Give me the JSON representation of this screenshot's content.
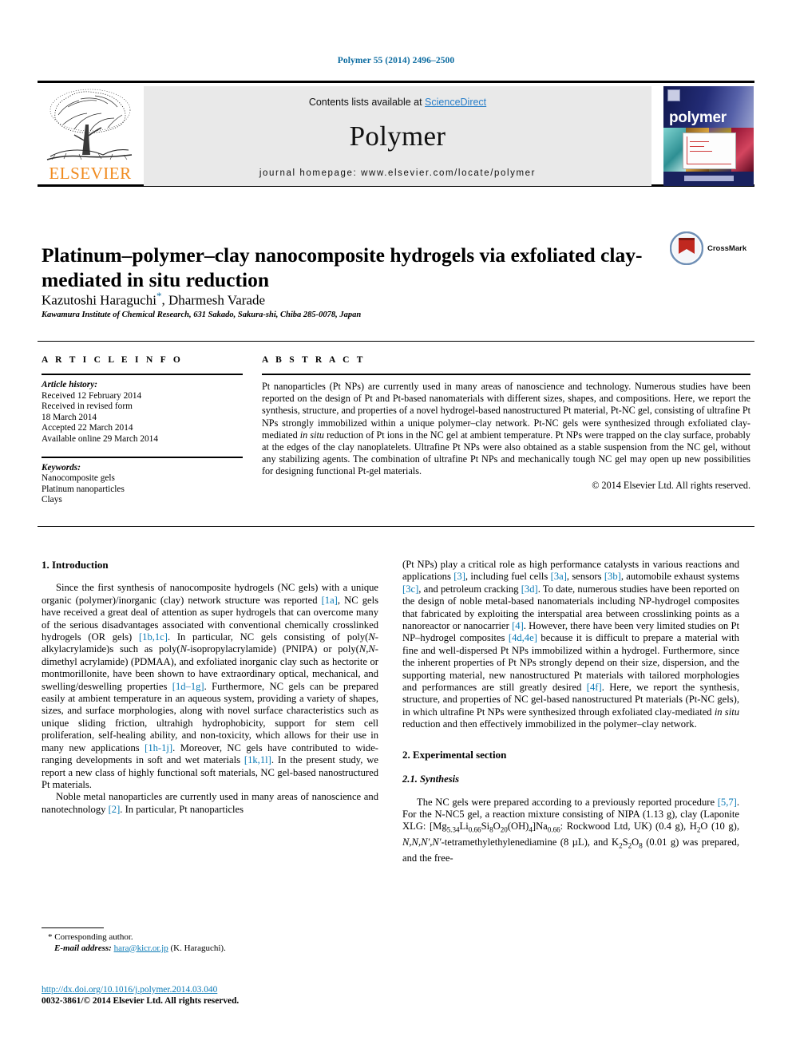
{
  "running_head": "Polymer 55 (2014) 2496–2500",
  "masthead": {
    "publisher": "ELSEVIER",
    "contents_prefix": "Contents lists available at ",
    "sciencedirect": "ScienceDirect",
    "journal_name": "Polymer",
    "homepage": "journal homepage: www.elsevier.com/locate/polymer",
    "cover_title": "polymer",
    "link_color": "#2a7fc9",
    "brand_color": "#f08a1e"
  },
  "article": {
    "title": "Platinum–polymer–clay nanocomposite hydrogels via exfoliated clay-mediated in situ reduction",
    "authors": "Kazutoshi Haraguchi",
    "authors_rest": ", Dharmesh Varade",
    "author_star": "*",
    "affiliation": "Kawamura Institute of Chemical Research, 631 Sakado, Sakura-shi, Chiba 285-0078, Japan",
    "crossmark_label": "CrossMark"
  },
  "info": {
    "heading": "A R T I C L E   I N F O",
    "history_label": "Article history:",
    "history": [
      "Received 12 February 2014",
      "Received in revised form",
      "18 March 2014",
      "Accepted 22 March 2014",
      "Available online 29 March 2014"
    ],
    "keywords_label": "Keywords:",
    "keywords": [
      "Nanocomposite gels",
      "Platinum nanoparticles",
      "Clays"
    ]
  },
  "abstract": {
    "heading": "A B S T R A C T",
    "text_part1": "Pt nanoparticles (Pt NPs) are currently used in many areas of nanoscience and technology. Numerous studies have been reported on the design of Pt and Pt-based nanomaterials with different sizes, shapes, and compositions. Here, we report the synthesis, structure, and properties of a novel hydrogel-based nanostructured Pt material, Pt-NC gel, consisting of ultrafine Pt NPs strongly immobilized within a unique polymer–clay network. Pt-NC gels were synthesized through exfoliated clay-mediated ",
    "italic1": "in situ",
    "text_part2": " reduction of Pt ions in the NC gel at ambient temperature. Pt NPs were trapped on the clay surface, probably at the edges of the clay nanoplatelets. Ultrafine Pt NPs were also obtained as a stable suspension from the NC gel, without any stabilizing agents. The combination of ultrafine Pt NPs and mechanically tough NC gel may open up new possibilities for designing functional Pt-gel materials.",
    "copyright": "© 2014 Elsevier Ltd. All rights reserved."
  },
  "sections": {
    "intro_heading": "1. Introduction",
    "experimental_heading": "2. Experimental section",
    "synthesis_heading": "2.1. Synthesis"
  },
  "footnote": {
    "corresponding": "* Corresponding author.",
    "email_label": "E-mail address:",
    "email": "hara@kicr.or.jp",
    "email_suffix": " (K. Haraguchi).",
    "doi": "http://dx.doi.org/10.1016/j.polymer.2014.03.040",
    "issn": "0032-3861/© 2014 Elsevier Ltd. All rights reserved."
  }
}
